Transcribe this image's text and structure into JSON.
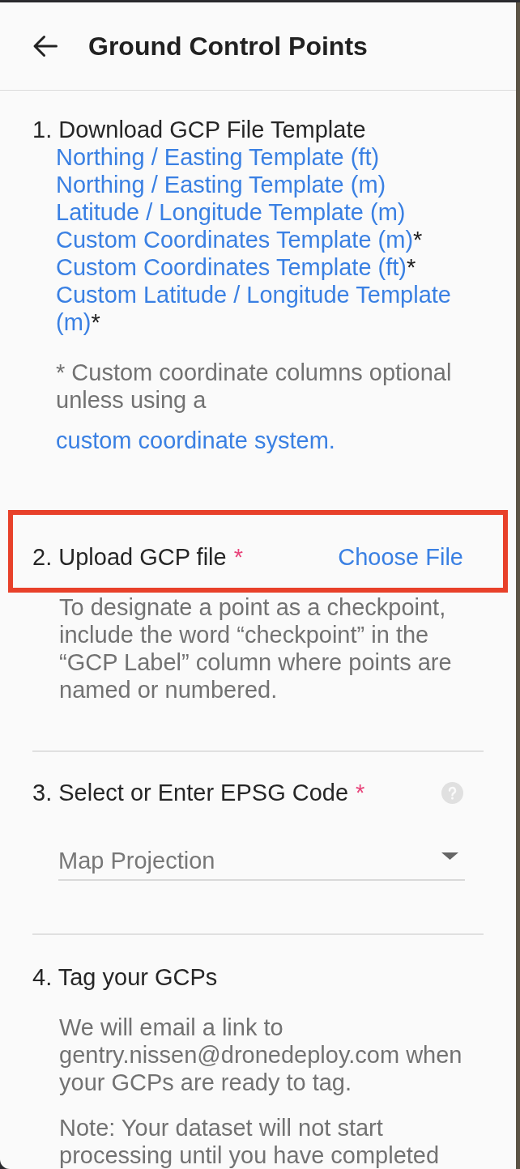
{
  "header": {
    "title": "Ground Control Points"
  },
  "steps": [
    {
      "kind": "downloads",
      "highlighted": false,
      "title": "1. Download GCP File Template",
      "links": [
        {
          "label": "Northing / Easting Template (ft)"
        },
        {
          "label": "Northing / Easting Template (m)"
        },
        {
          "label": "Latitude / Longitude Template (m)"
        },
        {
          "label": "Custom Coordinates Template (m)",
          "suffix": "*"
        },
        {
          "label": "Custom Coordinates Template (ft)",
          "suffix": "*"
        },
        {
          "label": "Custom Latitude / Longitude Template (m)",
          "suffix": "*"
        }
      ],
      "footnote": "* Custom coordinate columns optional unless using a",
      "footnote_link": "custom coordinate system."
    },
    {
      "kind": "upload",
      "highlighted": true,
      "title": "2. Upload GCP file",
      "required_mark": "*",
      "action": "Choose File",
      "description": "To designate a point as a checkpoint, include the word “checkpoint” in the “GCP Label” column where points are named or numbered."
    },
    {
      "kind": "select",
      "highlighted": false,
      "title": "3. Select or Enter EPSG Code",
      "required_mark": "*",
      "select": {
        "placeholder": "Map Projection"
      }
    },
    {
      "kind": "info",
      "highlighted": false,
      "title": "4. Tag your GCPs",
      "paragraphs": [
        "We will email a link to gentry.nissen@dronedeploy.com when your GCPs are ready to tag.",
        "Note: Your dataset will not start processing until you have completed"
      ]
    }
  ]
}
